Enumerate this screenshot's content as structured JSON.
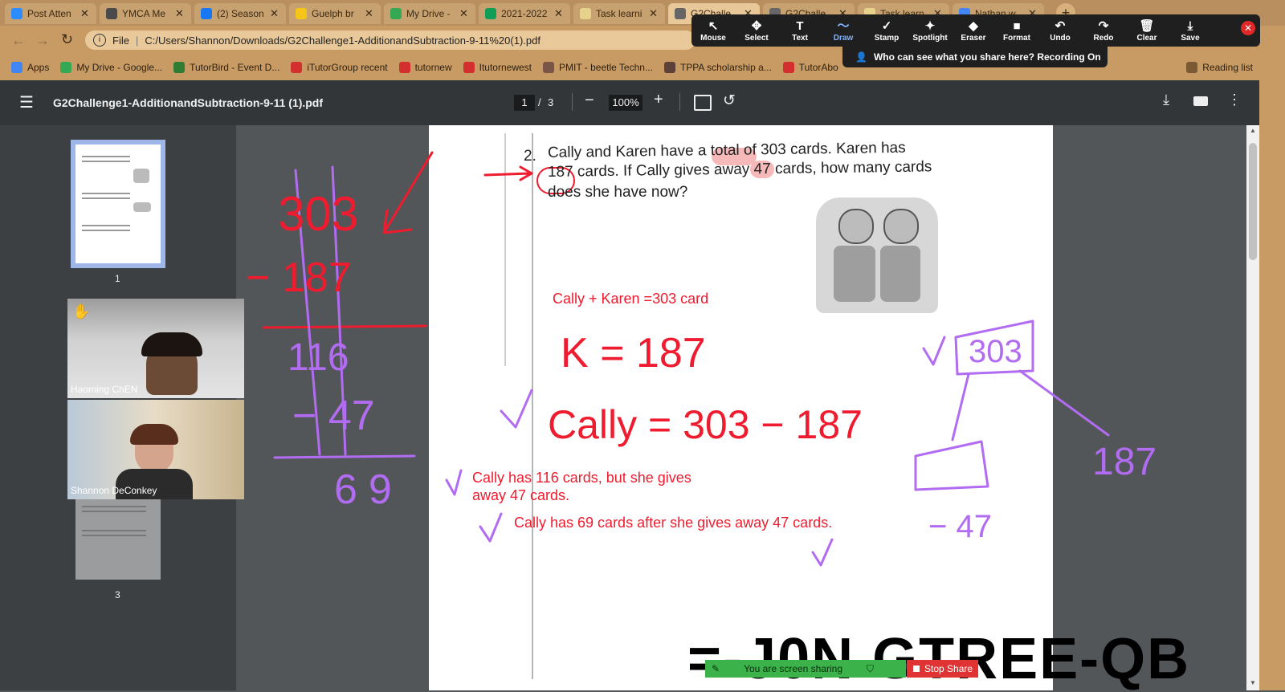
{
  "tabs": [
    {
      "title": "Post Atten",
      "color": "#2d8cff"
    },
    {
      "title": "YMCA Me",
      "color": "#4a4a4a"
    },
    {
      "title": "(2) Season",
      "color": "#1877f2"
    },
    {
      "title": "Guelph br",
      "color": "#f5c518"
    },
    {
      "title": "My Drive -",
      "color": "#34a853"
    },
    {
      "title": "2021-2022",
      "color": "#0f9d58"
    },
    {
      "title": "Task learni",
      "color": "#e6d28a"
    },
    {
      "title": "G2Challe",
      "color": "#666666"
    },
    {
      "title": "G2Challe",
      "color": "#666666"
    },
    {
      "title": "Task learn",
      "color": "#e6d28a"
    },
    {
      "title": "Nathan w",
      "color": "#4285f4"
    }
  ],
  "address": {
    "file_label": "File",
    "url": "C:/Users/Shannon/Downloads/G2Challenge1-AdditionandSubtraction-9-11%20(1).pdf"
  },
  "bookmarks": [
    {
      "label": "Apps",
      "color": "#4285f4"
    },
    {
      "label": "My Drive - Google...",
      "color": "#34a853"
    },
    {
      "label": "TutorBird - Event D...",
      "color": "#2e7d32"
    },
    {
      "label": "iTutorGroup recent",
      "color": "#d32f2f"
    },
    {
      "label": "tutornew",
      "color": "#d32f2f"
    },
    {
      "label": "Itutornewest",
      "color": "#d32f2f"
    },
    {
      "label": "PMIT - beetle Techn...",
      "color": "#795548"
    },
    {
      "label": "TPPA scholarship a...",
      "color": "#5d4037"
    },
    {
      "label": "TutorAbo",
      "color": "#d32f2f"
    },
    {
      "label": "Reading list",
      "color": "#7a5a32"
    }
  ],
  "zoom_toolbar": [
    {
      "label": "Mouse",
      "icon": "↖"
    },
    {
      "label": "Select",
      "icon": "✥"
    },
    {
      "label": "Text",
      "icon": "T"
    },
    {
      "label": "Draw",
      "icon": "〜"
    },
    {
      "label": "Stamp",
      "icon": "✓"
    },
    {
      "label": "Spotlight",
      "icon": "✦"
    },
    {
      "label": "Eraser",
      "icon": "◆"
    },
    {
      "label": "Format",
      "icon": "■"
    },
    {
      "label": "Undo",
      "icon": "↶"
    },
    {
      "label": "Redo",
      "icon": "↷"
    },
    {
      "label": "Clear",
      "icon": "🗑"
    },
    {
      "label": "Save",
      "icon": "⤓"
    }
  ],
  "share_notice": "Who can see what you share here? Recording On",
  "pdf": {
    "title": "G2Challenge1-AdditionandSubtraction-9-11 (1).pdf",
    "page_current": "1",
    "page_sep": "/",
    "page_total": "3",
    "zoom": "100%"
  },
  "thumbs": [
    {
      "num": "1"
    },
    {
      "num": "3"
    }
  ],
  "participants": [
    {
      "name": "Haoming ChEN"
    },
    {
      "name": "Shannon DeConkey"
    }
  ],
  "problem": {
    "number": "2.",
    "line1": "Cally and Karen have a total of 303 cards. Karen has",
    "line2": "187 cards. If Cally gives away 47 cards, how many cards",
    "line3": "does she have now?"
  },
  "annotations": {
    "eq1": "Cally + Karen =303 card",
    "k": "K = 187",
    "cally": "Cally = 303 − 187",
    "ans1a": "Cally has 116 cards, but she gives",
    "ans1b": "away 47 cards.",
    "ans2": "Cally has 69 cards after she gives away 47 cards."
  },
  "left_work": {
    "top": "303",
    "sub": "− 187",
    "mid": "116",
    "sub2": "− 47",
    "result": "69"
  },
  "bond": {
    "total": "303",
    "part": "187",
    "minus": "− 47"
  },
  "bottom_text": "=-J0N GTREE-QB",
  "share_bar": {
    "text": "You are screen sharing",
    "stop": "Stop Share"
  },
  "colors": {
    "red": "#ee1c2e",
    "purple": "#b26cf2",
    "zoom_blue": "#2d8cff"
  }
}
